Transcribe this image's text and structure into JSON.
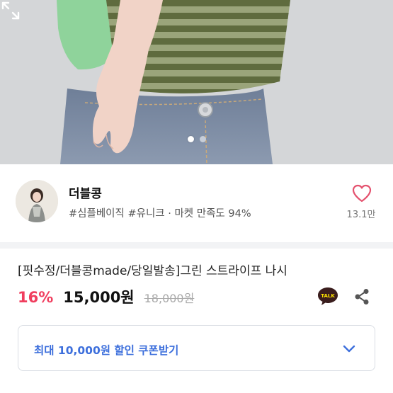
{
  "product_image": {
    "slide_count": 2,
    "active_slide": 1
  },
  "icons": {
    "expand": "expand-icon",
    "heart": "heart-icon",
    "talk": "kakaotalk-icon",
    "share": "share-icon",
    "chevron": "chevron-down-icon"
  },
  "seller": {
    "name": "더블콩",
    "tags": "#심플베이직 #유니크 · 마켓 만족도 94%",
    "like_count": "13.1만"
  },
  "product": {
    "title": "[핏수정/더블콩made/당일발송]그린 스트라이프 나시",
    "discount": "16%",
    "price": "15,000원",
    "original_price": "18,000원"
  },
  "talk_badge": "TALK",
  "coupon": {
    "label": "최대 10,000원 할인 쿠폰받기"
  },
  "colors": {
    "discount": "#f03e5e",
    "coupon_text": "#3d6fdc",
    "heart": "#e4516e",
    "talk_bg": "#3a1d1d",
    "divider": "#f2f3f5"
  }
}
